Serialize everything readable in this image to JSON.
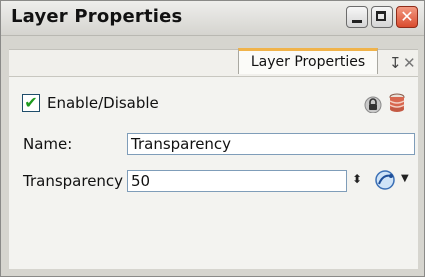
{
  "window": {
    "title": "Layer Properties",
    "close_glyph": "✕"
  },
  "tab": {
    "label": "Layer Properties",
    "pin_glyph": "↧",
    "close_glyph": "✕"
  },
  "properties": {
    "enable_label": "Enable/Disable",
    "enabled": true,
    "name_label": "Name:",
    "name_value": "Transparency",
    "transparency_label": "Transparency",
    "transparency_value": "50"
  },
  "icons": {
    "lock": "lock-icon",
    "database": "database-icon",
    "stepper": "stepper-arrows-icon",
    "curve": "curve-icon",
    "dropdown": "chevron-down-icon"
  }
}
